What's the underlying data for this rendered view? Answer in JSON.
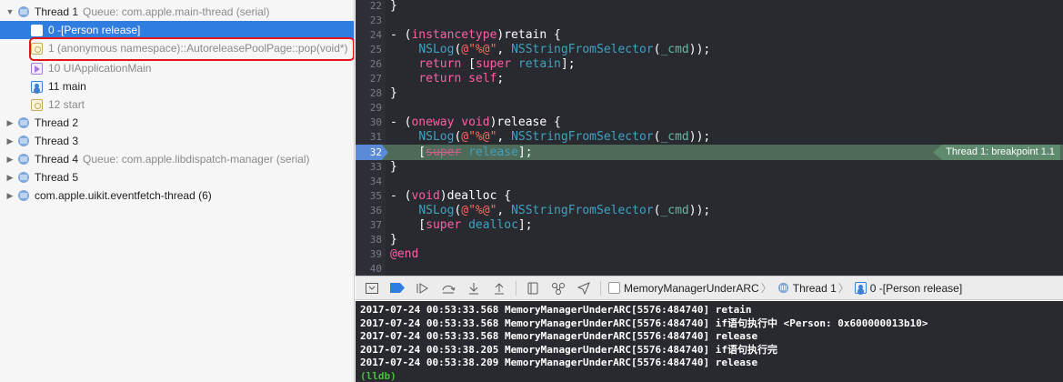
{
  "navigator": {
    "threads": [
      {
        "label": "Thread 1",
        "sub": "Queue: com.apple.main-thread (serial)",
        "expanded": true
      },
      {
        "label": "Thread 2",
        "sub": ""
      },
      {
        "label": "Thread 3",
        "sub": ""
      },
      {
        "label": "Thread 4",
        "sub": "Queue: com.apple.libdispatch-manager (serial)"
      },
      {
        "label": "Thread 5",
        "sub": ""
      },
      {
        "label": "com.apple.uikit.eventfetch-thread (6)",
        "sub": ""
      }
    ],
    "frames": [
      {
        "label": "0 -[Person release]",
        "selected": true
      },
      {
        "label": "1 (anonymous namespace)::AutoreleasePoolPage::pop(void*)",
        "highlighted": true
      },
      {
        "label": "10 UIApplicationMain"
      },
      {
        "label": "11 main"
      },
      {
        "label": "12 start"
      }
    ]
  },
  "editor": {
    "line_numbers": [
      "22",
      "23",
      "24",
      "25",
      "26",
      "27",
      "28",
      "29",
      "30",
      "31",
      "32",
      "33",
      "34",
      "35",
      "36",
      "37",
      "38",
      "39",
      "40"
    ],
    "current_line": "32",
    "breakpoint_label": "Thread 1: breakpoint 1.1"
  },
  "debug_bar": {
    "breadcrumbs": [
      "MemoryManagerUnderARC",
      "Thread 1",
      "0 -[Person release]"
    ]
  },
  "console": {
    "lines": [
      "2017-07-24 00:53:33.568 MemoryManagerUnderARC[5576:484740] retain",
      "2017-07-24 00:53:33.568 MemoryManagerUnderARC[5576:484740] if语句执行中 <Person: 0x600000013b10>",
      "2017-07-24 00:53:33.568 MemoryManagerUnderARC[5576:484740] release",
      "2017-07-24 00:53:38.205 MemoryManagerUnderARC[5576:484740] if语句执行完",
      "2017-07-24 00:53:38.209 MemoryManagerUnderARC[5576:484740] release"
    ],
    "prompt": "(lldb)"
  },
  "colors": {
    "accent": "#2f7de1",
    "annotation": "#e2151b",
    "breakpoint": "#5b8bd8",
    "current_line": "#4e6a58"
  }
}
